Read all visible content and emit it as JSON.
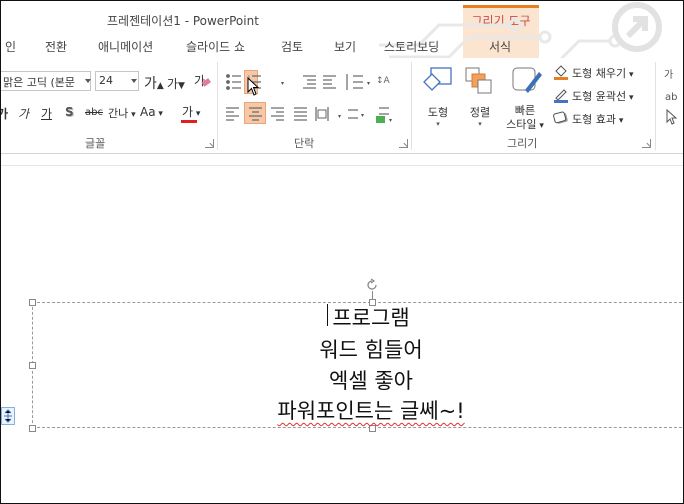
{
  "window": {
    "title": "프레젠테이션1 - PowerPoint",
    "contextual_group": "그리기 도구",
    "accent_color": "#e67e22"
  },
  "tabs": [
    {
      "label": "인",
      "active": false
    },
    {
      "label": "전환",
      "active": false
    },
    {
      "label": "애니메이션",
      "active": false
    },
    {
      "label": "슬라이드 쇼",
      "active": false
    },
    {
      "label": "검토",
      "active": false
    },
    {
      "label": "보기",
      "active": false
    },
    {
      "label": "스토리보딩",
      "active": false
    },
    {
      "label": "서식",
      "active": false
    }
  ],
  "ribbon": {
    "font_group": {
      "label": "글꼴",
      "font_name": "맑은 고딕 (본문",
      "font_size": "24",
      "grow_label": "가",
      "shrink_label": "가",
      "italic": "가",
      "underline": "가",
      "shadow": "S",
      "strike": "abc",
      "spacing": "간나",
      "case": "Aa",
      "font_color_label": "가",
      "font_color": "#e02020"
    },
    "paragraph_group": {
      "label": "단락"
    },
    "drawing_group": {
      "label": "그리기",
      "shapes_label": "도형",
      "arrange_label": "정렬",
      "quick_styles_line1": "빠른",
      "quick_styles_line2": "스타일",
      "shape_fill": "도형 채우기",
      "shape_outline": "도형 윤곽선",
      "shape_effects": "도형 효과"
    }
  },
  "slide": {
    "text_lines": [
      "프로그램",
      "워드 힘들어",
      "엑셀 좋아",
      "파워포인트는 글쎄~!"
    ]
  }
}
